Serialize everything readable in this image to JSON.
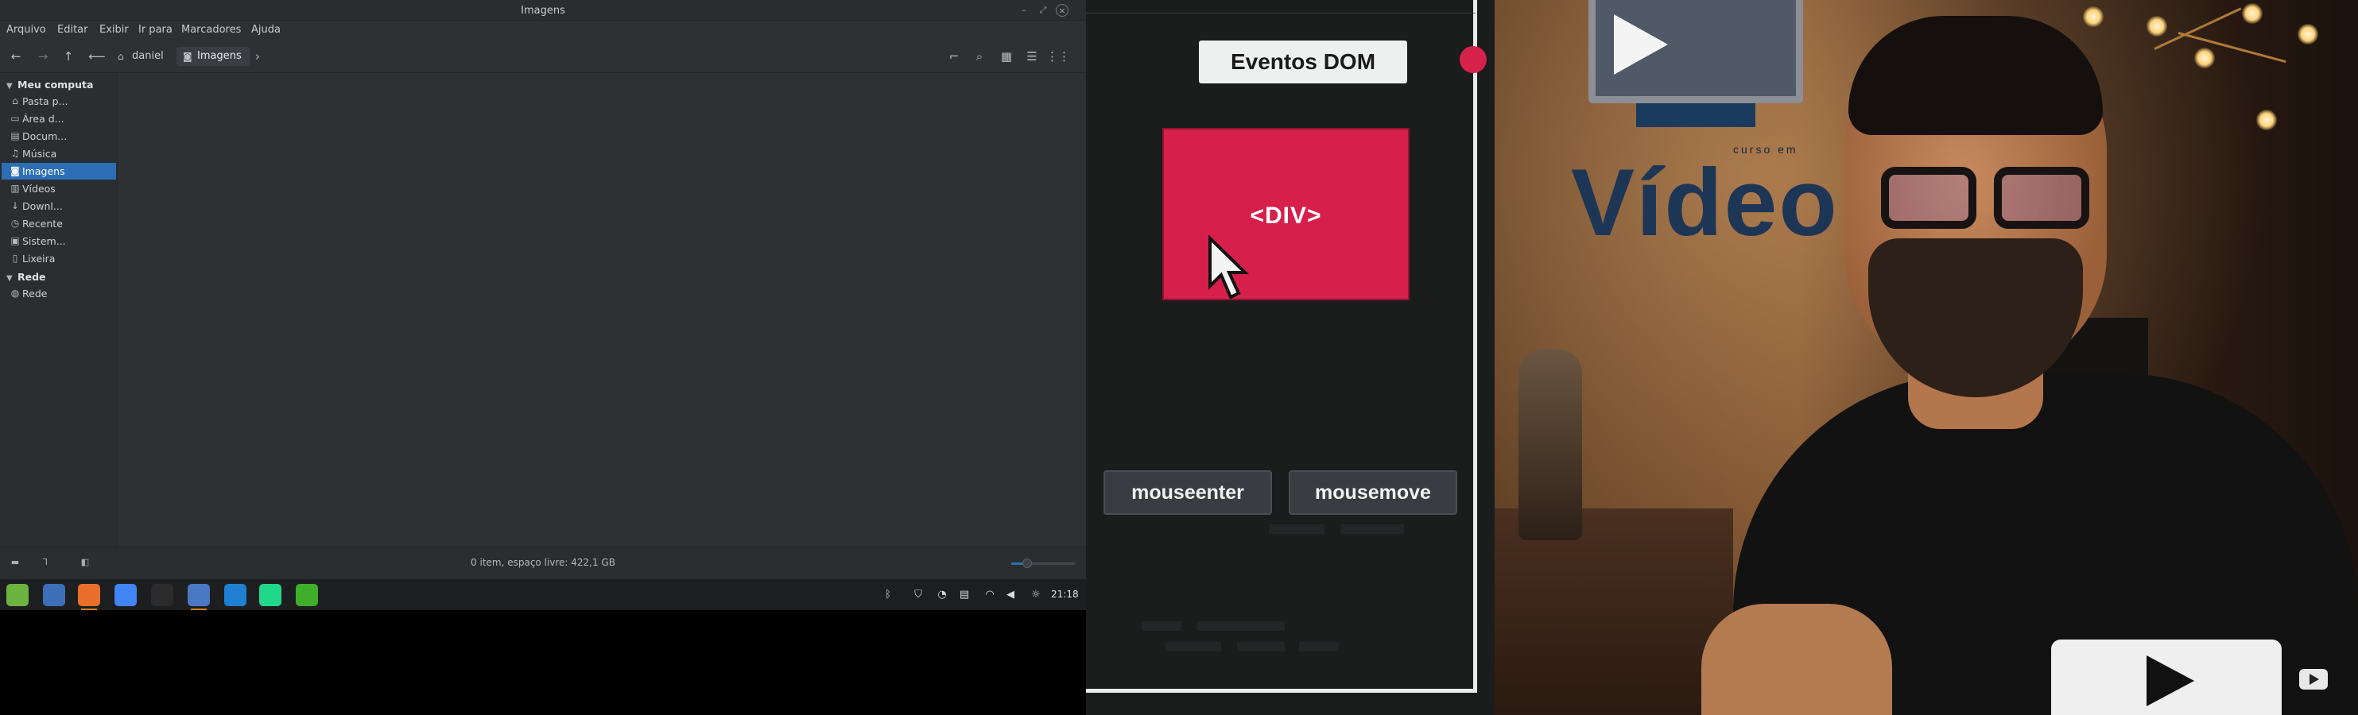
{
  "window": {
    "title": "Imagens",
    "controls": [
      "–",
      "⤢",
      "×"
    ]
  },
  "menu": [
    "Arquivo",
    "Editar",
    "Exibir",
    "Ir para",
    "Marcadores",
    "Ajuda"
  ],
  "breadcrumb": [
    {
      "label": "daniel",
      "icon": "home-icon"
    },
    {
      "label": "Imagens",
      "icon": "camera-icon"
    }
  ],
  "sidebar": {
    "sections": [
      {
        "title": "Meu computa",
        "items": [
          {
            "label": "Pasta p...",
            "icon": "home-icon",
            "glyph": "⌂"
          },
          {
            "label": "Área d...",
            "icon": "desktop-icon",
            "glyph": "▭"
          },
          {
            "label": "Docum...",
            "icon": "document-icon",
            "glyph": "▤"
          },
          {
            "label": "Música",
            "icon": "music-icon",
            "glyph": "♫"
          },
          {
            "label": "Imagens",
            "icon": "camera-icon",
            "glyph": "◙",
            "selected": true
          },
          {
            "label": "Vídeos",
            "icon": "film-icon",
            "glyph": "▥"
          },
          {
            "label": "Downl...",
            "icon": "download-icon",
            "glyph": "↓"
          },
          {
            "label": "Recente",
            "icon": "clock-icon",
            "glyph": "◷"
          },
          {
            "label": "Sistem...",
            "icon": "drive-icon",
            "glyph": "▣"
          },
          {
            "label": "Lixeira",
            "icon": "trash-icon",
            "glyph": "▯"
          }
        ]
      },
      {
        "title": "Rede",
        "items": [
          {
            "label": "Rede",
            "icon": "network-icon",
            "glyph": "◍"
          }
        ]
      }
    ]
  },
  "status": {
    "text": "0 item, espaço livre: 422,1 GB",
    "zoom_level": 0.25
  },
  "taskbar": {
    "apps": [
      {
        "name": "mint-menu-icon",
        "color": "#6db33f"
      },
      {
        "name": "show-desktop-icon",
        "color": "#3d6fb8"
      },
      {
        "name": "firefox-icon",
        "color": "#e8702a",
        "running": true
      },
      {
        "name": "chrome-icon",
        "color": "#4285f4"
      },
      {
        "name": "terminal-icon",
        "color": "#2b2b2b"
      },
      {
        "name": "files-icon",
        "color": "#4a78c2",
        "running": true
      },
      {
        "name": "vscode-icon",
        "color": "#1f7fd0"
      },
      {
        "name": "pycharm-icon",
        "color": "#21d789"
      },
      {
        "name": "green-app-icon",
        "color": "#3fae2a"
      }
    ],
    "tray": [
      {
        "name": "bluetooth-icon",
        "glyph": "ᛒ"
      },
      {
        "name": "shield-icon",
        "glyph": "⛉"
      },
      {
        "name": "update-icon",
        "glyph": "◔"
      },
      {
        "name": "drive-tray-icon",
        "glyph": "▤"
      },
      {
        "name": "wifi-icon",
        "glyph": "◠"
      },
      {
        "name": "volume-icon",
        "glyph": "◀"
      },
      {
        "name": "brightness-icon",
        "glyph": "☼"
      }
    ],
    "clock": "21:18"
  },
  "video": {
    "demo_title": "Eventos DOM",
    "div_label": "<DIV>",
    "buttons": [
      "mouseenter",
      "mousemove"
    ],
    "brand_text": "Vídeo",
    "brand_small": "curso em"
  }
}
